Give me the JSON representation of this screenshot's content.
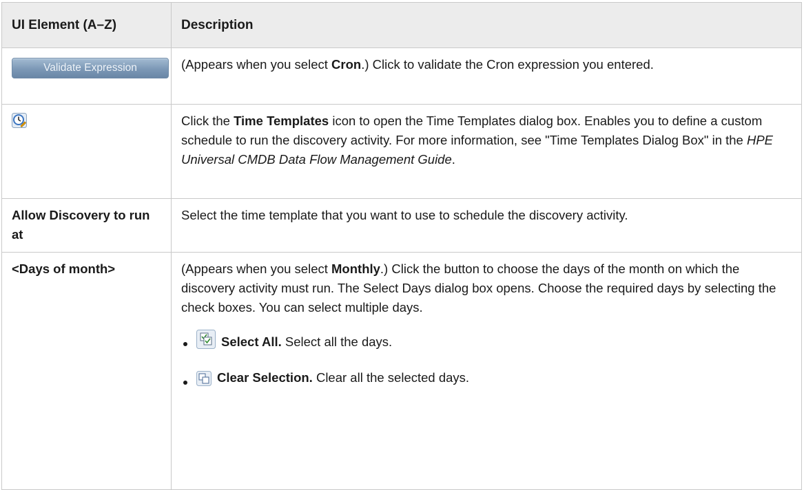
{
  "header": {
    "col1": "UI Element (A–Z)",
    "col2": "Description"
  },
  "rows": {
    "validate": {
      "button_label": "Validate Expression",
      "d1": "(Appears when you select ",
      "d2": "Cron",
      "d3": ".) Click to validate the Cron expression you entered."
    },
    "time_templates": {
      "icon": "time-templates-icon",
      "d1": "Click the ",
      "d2": "Time Templates",
      "d3": " icon to open the Time Templates dialog box. Enables you to define a custom schedule to run the discovery activity. For more information, see \"Time Templates Dialog Box\" in the ",
      "d4": "HPE Universal CMDB Data Flow Management Guide",
      "d5": "."
    },
    "allow_discovery": {
      "element": "Allow Discovery to run at",
      "description": "Select the time template that you want to use to schedule the discovery activity."
    },
    "days_of_month": {
      "element": "<Days of month>",
      "d1": "(Appears when you select ",
      "d2": "Monthly",
      "d3": ".) Click the button to choose the days of the month on which the discovery activity must run. The Select Days dialog box opens. Choose the required days by selecting the check boxes. You can select multiple days.",
      "options": [
        {
          "icon": "select-all-icon",
          "label": "Select All.",
          "text": " Select all the days."
        },
        {
          "icon": "clear-selection-icon",
          "label": "Clear Selection.",
          "text": " Clear all the selected days."
        }
      ]
    }
  },
  "colors": {
    "header_bg": "#ececec",
    "border": "#c9c9c9",
    "button": "#7c98b6"
  }
}
